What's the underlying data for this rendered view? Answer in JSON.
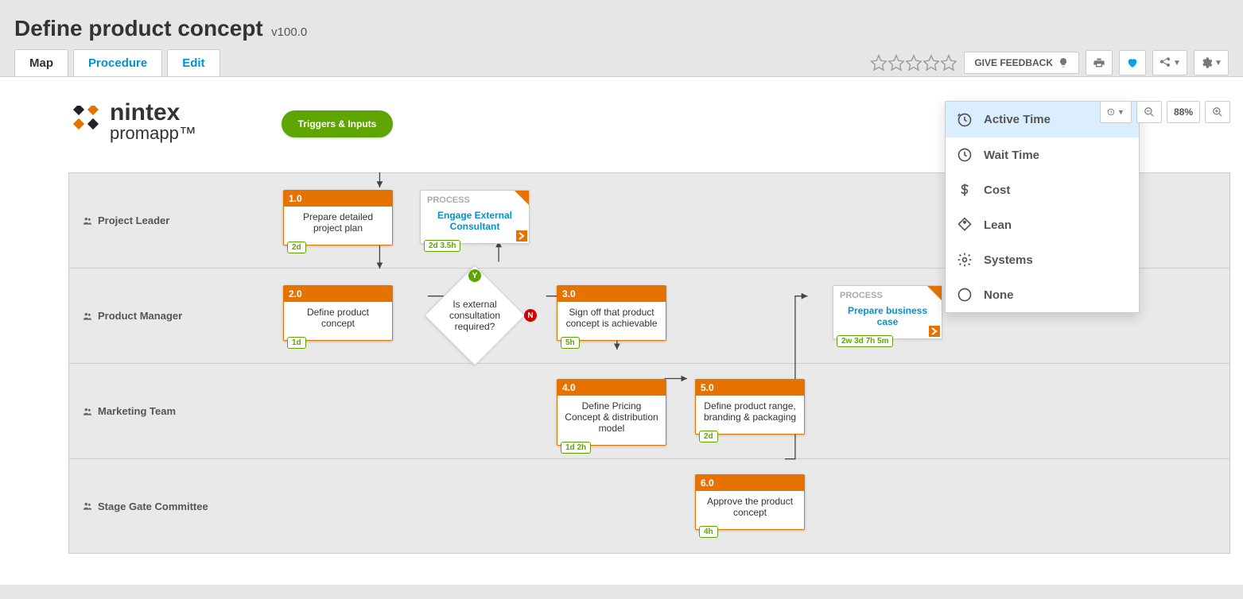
{
  "header": {
    "title": "Define product concept",
    "version": "v100.0"
  },
  "tabs": {
    "map": "Map",
    "procedure": "Procedure",
    "edit": "Edit"
  },
  "toolbar": {
    "give_feedback": "GIVE FEEDBACK"
  },
  "canvas_controls": {
    "zoom_value": "88%"
  },
  "time_dropdown": {
    "active_time": "Active Time",
    "wait_time": "Wait Time",
    "cost": "Cost",
    "lean": "Lean",
    "systems": "Systems",
    "none": "None"
  },
  "logo": {
    "line1": "nintex",
    "line2": "promapp™"
  },
  "lanes": {
    "l1": "Project Leader",
    "l2": "Product Manager",
    "l3": "Marketing Team",
    "l4": "Stage Gate Committee"
  },
  "trigger": {
    "label": "Triggers & Inputs"
  },
  "process_label": "PROCESS",
  "steps": {
    "s1": {
      "num": "1.0",
      "title": "Prepare detailed project plan",
      "dur": "2d"
    },
    "s2": {
      "num": "2.0",
      "title": "Define product concept",
      "dur": "1d"
    },
    "s3": {
      "num": "3.0",
      "title": "Sign off that product concept is achievable",
      "dur": "5h"
    },
    "s4": {
      "num": "4.0",
      "title": "Define Pricing Concept & distribution model",
      "dur": "1d 2h"
    },
    "s5": {
      "num": "5.0",
      "title": "Define product range, branding & packaging",
      "dur": "2d"
    },
    "s6": {
      "num": "6.0",
      "title": "Approve the product concept",
      "dur": "4h"
    }
  },
  "linked": {
    "p1": {
      "title": "Engage External Consultant",
      "dur": "2d 3.5h"
    },
    "p2": {
      "title": "Prepare business case",
      "dur": "2w 3d 7h 5m"
    }
  },
  "decision": {
    "text": "Is external consultation required?",
    "yes": "Y",
    "no": "N"
  }
}
